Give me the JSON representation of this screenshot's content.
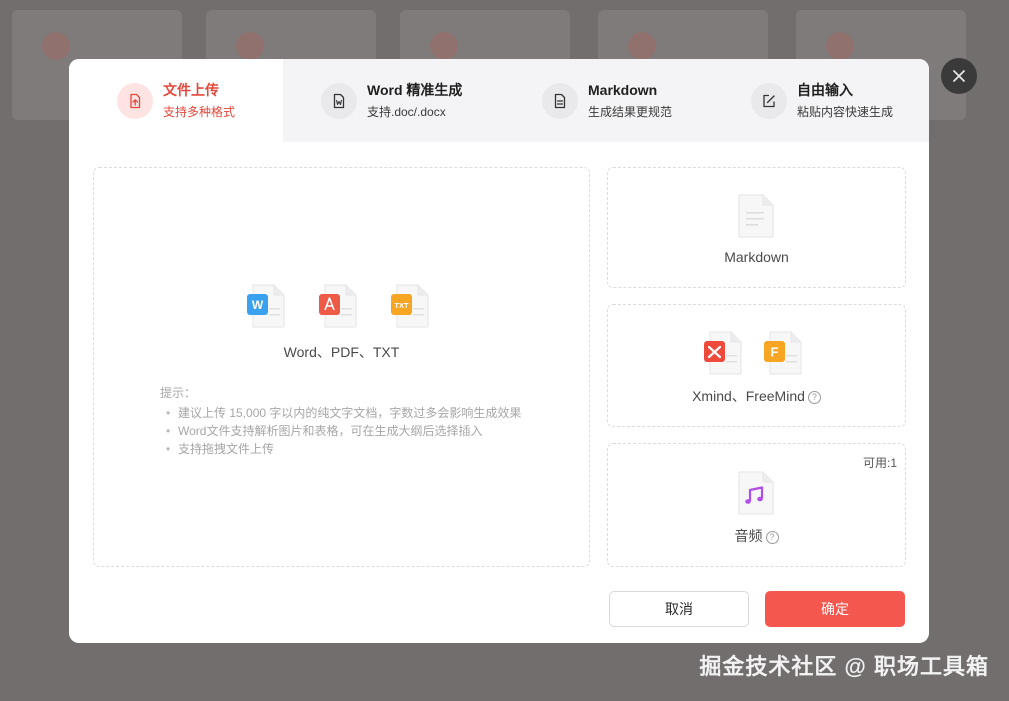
{
  "tabs": [
    {
      "title": "文件上传",
      "sub": "支持多种格式",
      "icon": "upload-file-icon",
      "active": true
    },
    {
      "title": "Word 精准生成",
      "sub": "支持.doc/.docx",
      "icon": "word-doc-icon",
      "active": false
    },
    {
      "title": "Markdown",
      "sub": "生成结果更规范",
      "icon": "document-lines-icon",
      "active": false
    },
    {
      "title": "自由输入",
      "sub": "粘贴内容快速生成",
      "icon": "edit-icon",
      "active": false
    }
  ],
  "upload": {
    "formats_label": "Word、PDF、TXT",
    "tips_title": "提示：",
    "tips": [
      "建议上传 15,000 字以内的纯文字文档，字数过多会影响生成效果",
      "Word文件支持解析图片和表格，可在生成大纲后选择插入",
      "支持拖拽文件上传"
    ]
  },
  "options": {
    "markdown": {
      "label": "Markdown"
    },
    "mindmap": {
      "label": "Xmind、FreeMind",
      "help": "?"
    },
    "audio": {
      "label": "音频",
      "help": "?",
      "available": "可用:1"
    }
  },
  "icons": {
    "word_badge": "W",
    "txt_badge": "TXT",
    "freemind_badge": "F"
  },
  "buttons": {
    "cancel": "取消",
    "confirm": "确定"
  },
  "watermark": "掘金技术社区 @ 职场工具箱",
  "colors": {
    "accent": "#f4574d",
    "active_text": "#e4483b",
    "tab_bg": "#f4f4f6"
  }
}
